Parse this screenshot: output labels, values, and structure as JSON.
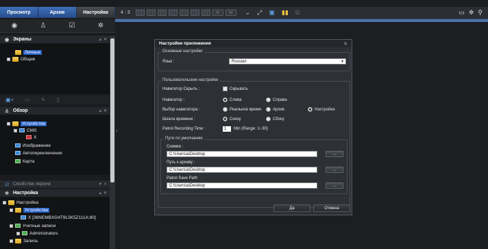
{
  "tabs": [
    "Просмотр",
    "Архив",
    "Настройка"
  ],
  "screens": {
    "title": "Экраны",
    "items": [
      "Личные",
      "Общие"
    ]
  },
  "overview": {
    "title": "Обзор",
    "items": [
      "Устройства",
      "CMS",
      "X",
      "Изображение",
      "Автопереключение",
      "Карта"
    ]
  },
  "screen_props": "Свойства экрана",
  "settings": {
    "title": "Настройка",
    "items": [
      "Настройка",
      "Устройства",
      "X [36NEMBXG4T9L5K5Z111A:80]",
      "Учетные записи",
      "Administrators",
      "Запись"
    ]
  },
  "toolbar": {
    "ratio": "4 : 3",
    "grid36": "36",
    "grid64": "64"
  },
  "dialog": {
    "title": "Настройки приложения",
    "basic_group": "Основные настройки",
    "language_label": "Язык :",
    "language_value": "Russian",
    "user_group": "Пользовательские настройки",
    "nav_hide_label": "Навигатор Скрыть :",
    "nav_hide_value": "Скрывать",
    "navigator_label": "Навигатор :",
    "nav_left": "Слева",
    "nav_right": "Справа",
    "nav_select_label": "Выбор навигатора :",
    "opt_realtime": "Реальное время",
    "opt_archive": "Архив",
    "opt_settings": "Настройка",
    "timeline_label": "Шкала времени :",
    "opt_bottom": "Снизу",
    "opt_side": "Сбоку",
    "patrol_label": "Patrol Recording Time :",
    "patrol_value": "1",
    "patrol_range": "Min (Range: 1~30)",
    "paths_group": "Пути по умолчанию",
    "snapshots_label": "Снимки :",
    "snapshots_path": "C:\\Users\\a\\Desktop",
    "archive_label": "Путь к архиву :",
    "archive_path": "C:\\Users\\a\\Desktop",
    "patrol_path_label": "Patrol Save Path",
    "patrol_path": "C:\\Users\\a\\Desktop",
    "browse": "...",
    "ok": "Да",
    "cancel": "Отмена"
  }
}
